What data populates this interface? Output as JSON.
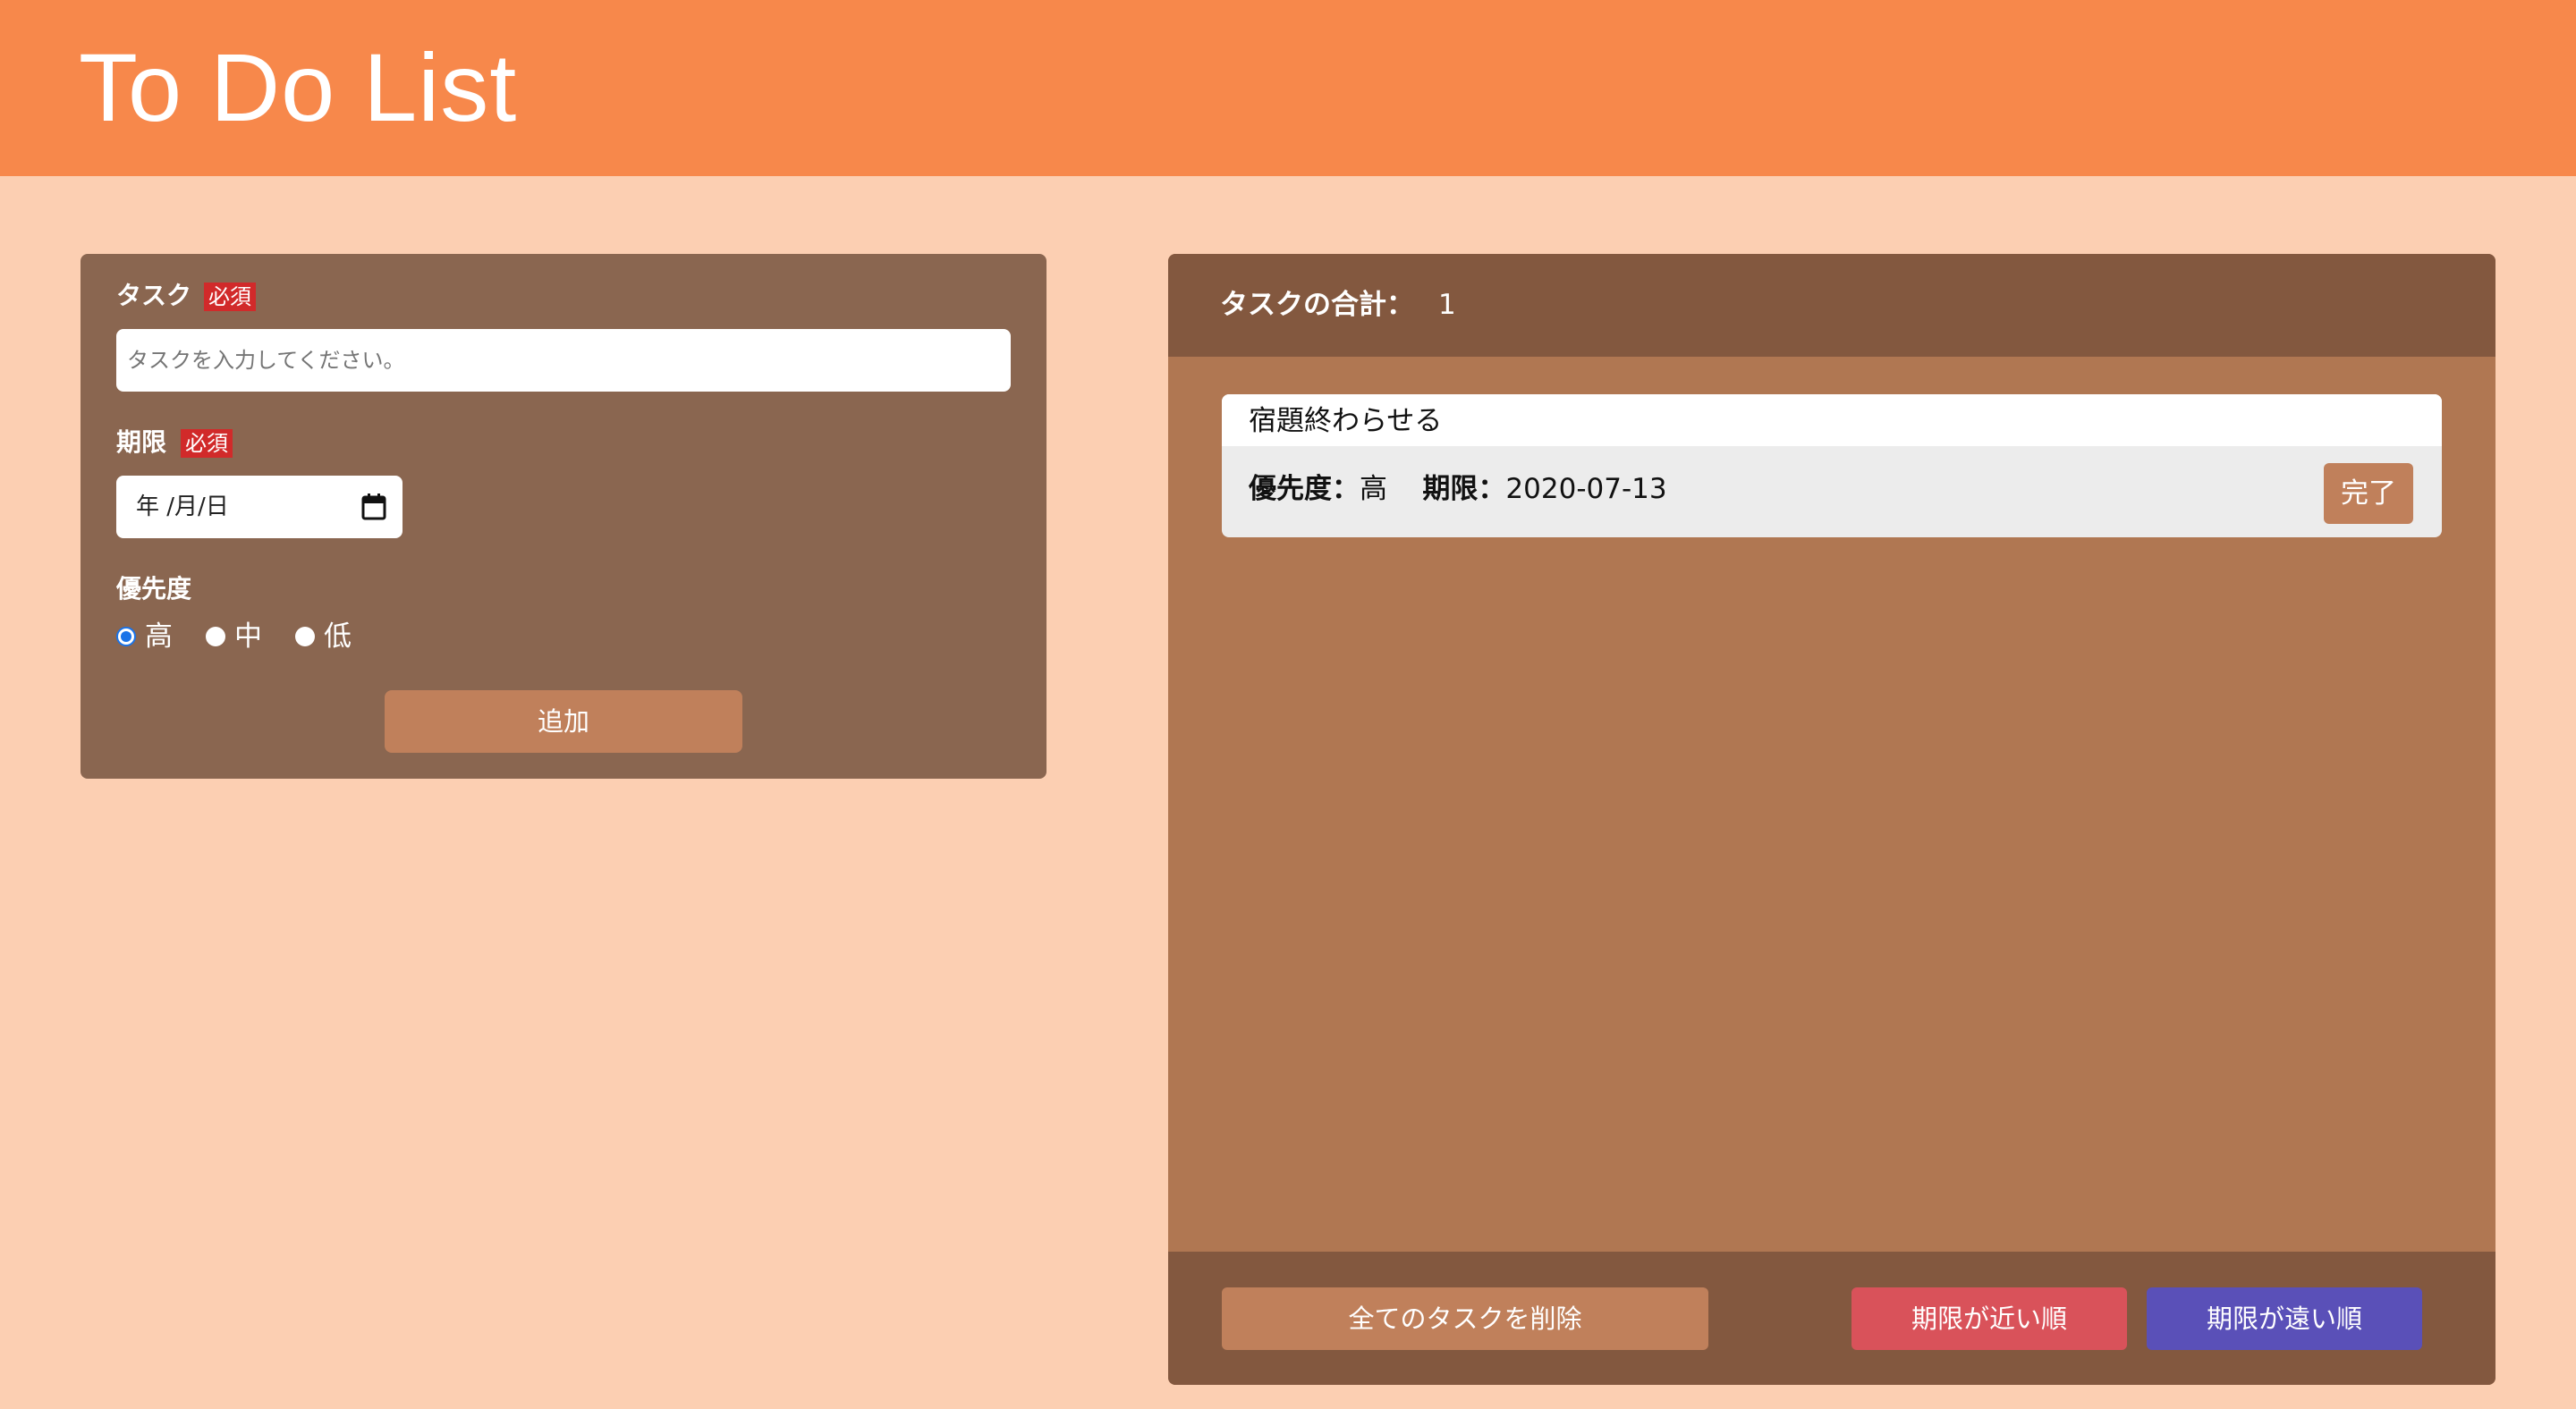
{
  "header": {
    "title": "To Do List"
  },
  "form": {
    "task_label": "タスク",
    "task_required": "必須",
    "task_placeholder": "タスクを入力してください。",
    "deadline_label": "期限",
    "deadline_required": "必須",
    "deadline_value": "年 /月/日",
    "priority_label": "優先度",
    "priority_options": [
      "高",
      "中",
      "低"
    ],
    "priority_selected": "高",
    "add_label": "追加"
  },
  "list": {
    "total_label": "タスクの合計：",
    "total_count": "1",
    "tasks": [
      {
        "name": "宿題終わらせる",
        "priority_label": "優先度：",
        "priority": "高",
        "deadline_label": "期限：",
        "deadline": "2020-07-13",
        "complete_label": "完了"
      }
    ],
    "footer": {
      "delete_all_label": "全てのタスクを削除",
      "sort_near_label": "期限が近い順",
      "sort_far_label": "期限が遠い順"
    }
  },
  "colors": {
    "header_bg": "#f7884b",
    "page_bg": "#fccfb2",
    "form_panel_bg": "#8a6650",
    "list_panel_bg": "#b07752",
    "list_header_bg": "#83583f",
    "button_bg": "#c0805b",
    "required_badge": "#d12a2a",
    "sort_near_bg": "#d9525a",
    "sort_far_bg": "#5a50b8"
  }
}
